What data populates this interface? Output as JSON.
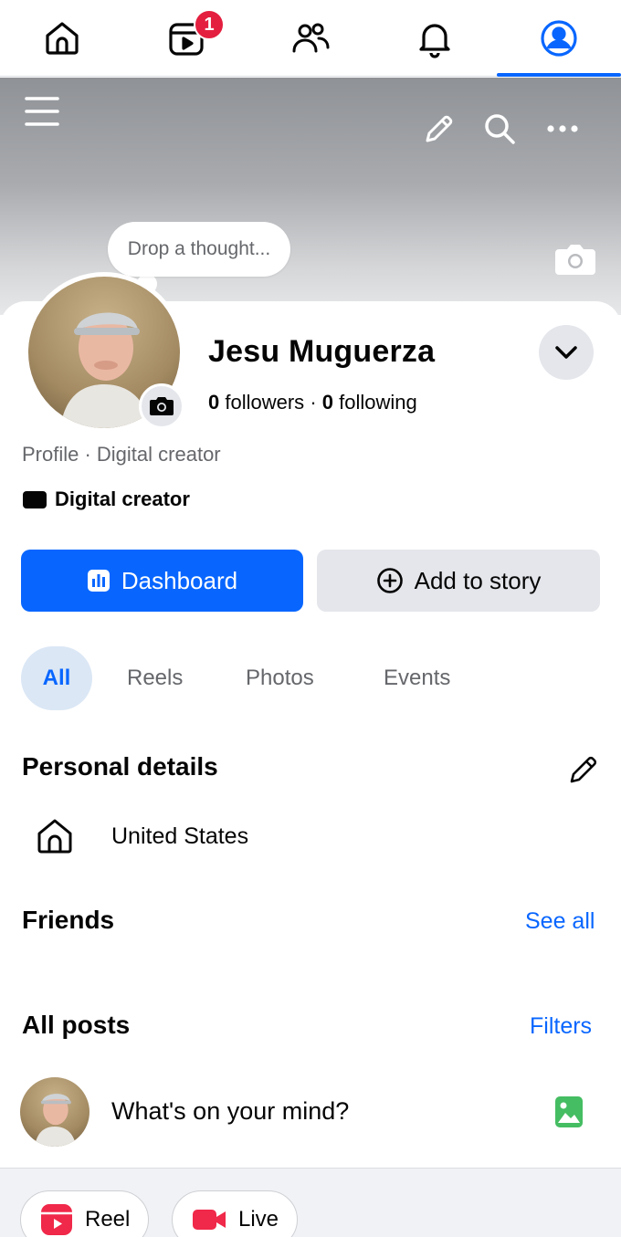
{
  "topnav": {
    "tabs": [
      {
        "name": "home-icon"
      },
      {
        "name": "video-icon",
        "badge": "1"
      },
      {
        "name": "friends-icon"
      },
      {
        "name": "bell-icon"
      },
      {
        "name": "profile-icon",
        "active": true
      }
    ]
  },
  "cover": {
    "thought_placeholder": "Drop a thought..."
  },
  "profile": {
    "name": "Jesu Muguerza",
    "followers_count": "0",
    "followers_label": "followers",
    "separator": "·",
    "following_count": "0",
    "following_label": "following",
    "subtitle": "Profile · Digital creator",
    "category": "Digital creator"
  },
  "actions": {
    "dashboard_label": "Dashboard",
    "add_story_label": "Add to story"
  },
  "tabs": [
    "All",
    "Reels",
    "Photos",
    "Events"
  ],
  "personal_details": {
    "title": "Personal details",
    "location": "United States"
  },
  "friends": {
    "title": "Friends",
    "see_all": "See all"
  },
  "posts": {
    "title": "All posts",
    "filters": "Filters",
    "composer_placeholder": "What's on your mind?"
  },
  "composer_actions": {
    "reel_label": "Reel",
    "live_label": "Live"
  },
  "colors": {
    "accent": "#0866ff",
    "badge": "#e41e3f",
    "secondary_button": "#e4e6eb",
    "muted_text": "#65676b"
  }
}
